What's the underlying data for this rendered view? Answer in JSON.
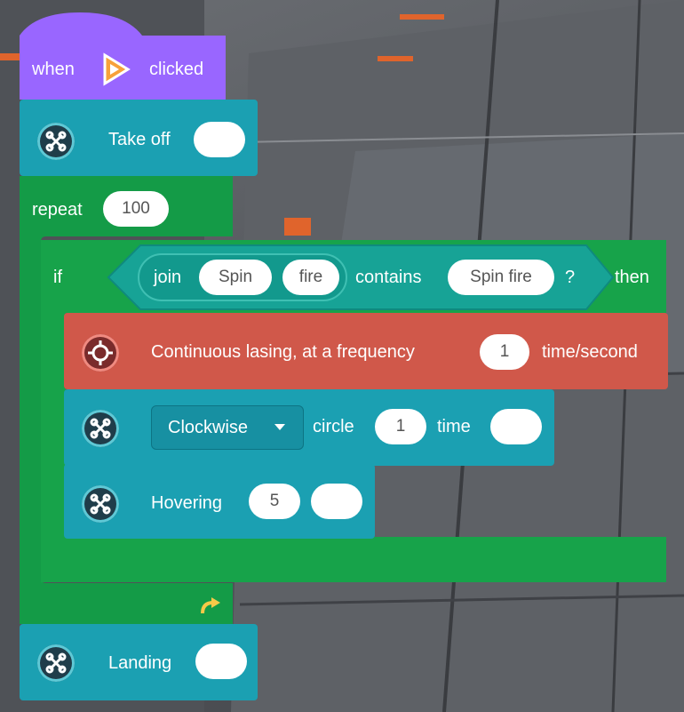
{
  "hat": {
    "when_label": "when",
    "icon": "flag-play-icon",
    "clicked_label": "clicked"
  },
  "takeoff": {
    "label": "Take off",
    "value": ""
  },
  "repeat": {
    "label": "repeat",
    "count": "100"
  },
  "if_block": {
    "if_label": "if",
    "join_label": "join",
    "join_a": "Spin",
    "join_b": "fire",
    "contains_label": "contains",
    "contains_value": "Spin fire",
    "question": "?",
    "then_label": "then"
  },
  "laser": {
    "label": "Continuous lasing, at a frequency",
    "value": "1",
    "unit": "time/second"
  },
  "circle": {
    "direction": "Clockwise",
    "circle_label": "circle",
    "count": "1",
    "time_label": "time",
    "value": ""
  },
  "hover": {
    "label": "Hovering",
    "seconds": "5",
    "value": ""
  },
  "landing": {
    "label": "Landing",
    "value": ""
  },
  "colors": {
    "event_purple": "#9966ff",
    "drone_teal": "#1ba0b2",
    "control_green": "#149b47",
    "operator_teal": "#17a396",
    "laser_red": "#d0584a"
  }
}
